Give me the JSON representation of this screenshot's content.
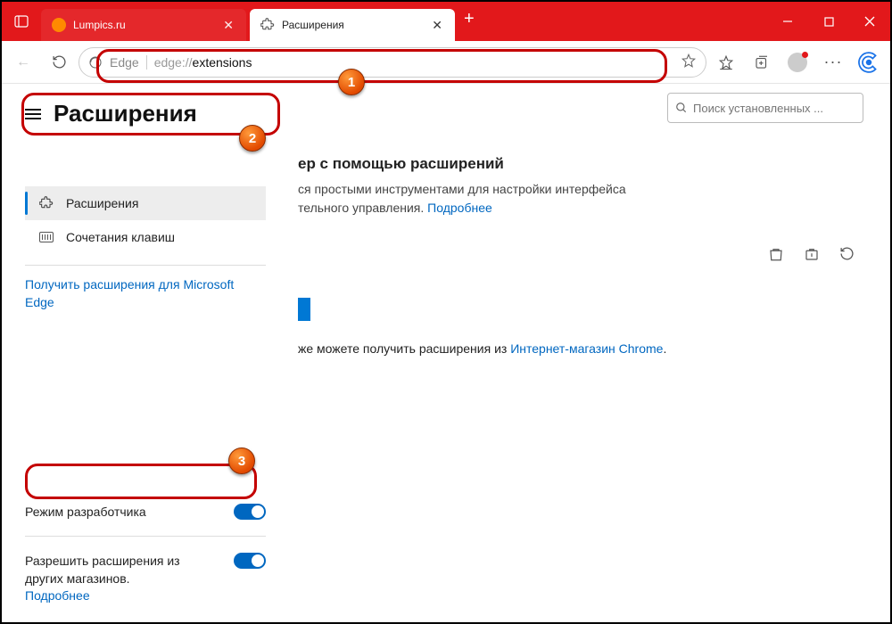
{
  "tabs": [
    {
      "title": "Lumpics.ru"
    },
    {
      "title": "Расширения"
    }
  ],
  "address": {
    "proto": "Edge",
    "prefix": "edge://",
    "path": "extensions"
  },
  "sidebar": {
    "page_title": "Расширения",
    "items": [
      {
        "label": "Расширения"
      },
      {
        "label": "Сочетания клавиш"
      }
    ],
    "get_ext_link": "Получить расширения для Microsoft Edge",
    "dev_mode_label": "Режим разработчика",
    "other_stores_label": "Разрешить расширения из других магазинов.",
    "learn_more": "Подробнее"
  },
  "content": {
    "search_placeholder": "Поиск установленных ...",
    "heading_fragment": "ер с помощью расширений",
    "desc_fragment_1": "ся простыми инструментами для настройки интерфейса",
    "desc_fragment_2": "тельного управления.",
    "learn_more": "Подробнее",
    "store_fragment": "же можете получить расширения из",
    "chrome_store": "Интернет-магазин Chrome"
  },
  "callouts": {
    "1": "1",
    "2": "2",
    "3": "3"
  }
}
